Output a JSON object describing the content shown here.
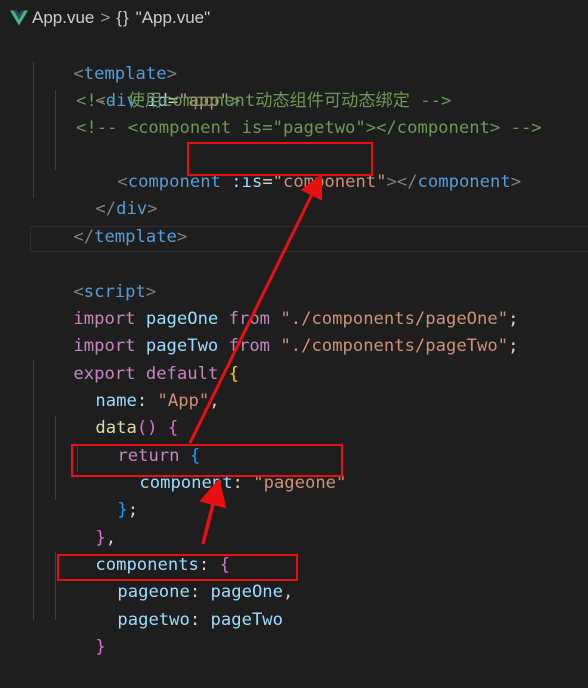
{
  "breadcrumb": {
    "file": "App.vue",
    "separator": ">",
    "symbol_icon_text": "{}",
    "symbol": "\"App.vue\""
  },
  "code": {
    "l1": [
      "<",
      "template",
      ">"
    ],
    "l2": [
      "<",
      "div",
      " ",
      "id",
      "=",
      "\"app\"",
      ">"
    ],
    "l3": "<!-- 使用component动态组件可动态绑定 -->",
    "l4": "<!-- <component is=\"pagetwo\"></component> -->",
    "l5": [
      "<",
      "component",
      " ",
      ":is",
      "=",
      "\"component\"",
      "></",
      "component",
      ">"
    ],
    "l6": [
      "</",
      "div",
      ">"
    ],
    "l7": [
      "</",
      "template",
      ">"
    ],
    "l9": [
      "<",
      "script",
      ">"
    ],
    "l10": [
      "import",
      " pageOne ",
      "from",
      " ",
      "\"./components/pageOne\"",
      ";"
    ],
    "l11": [
      "import",
      " pageTwo ",
      "from",
      " ",
      "\"./components/pageTwo\"",
      ";"
    ],
    "l12": [
      "export",
      " ",
      "default",
      " ",
      "{"
    ],
    "l13": [
      "name",
      ": ",
      "\"App\"",
      ","
    ],
    "l14": [
      "data",
      "()",
      " ",
      "{"
    ],
    "l15": [
      "return",
      " ",
      "{"
    ],
    "l16": [
      "component",
      ": ",
      "\"pageone\""
    ],
    "l17": [
      "}",
      ";"
    ],
    "l18": [
      "}",
      ","
    ],
    "l19": [
      "components",
      ": ",
      "{"
    ],
    "l20": [
      "pageone",
      ": ",
      "pageOne",
      ","
    ],
    "l21": [
      "pagetwo",
      ": ",
      "pageTwo"
    ],
    "l22": [
      "}"
    ]
  },
  "colors": {
    "highlight_box": "#e81010",
    "arrow": "#e81010",
    "background": "#1e1e1e"
  }
}
